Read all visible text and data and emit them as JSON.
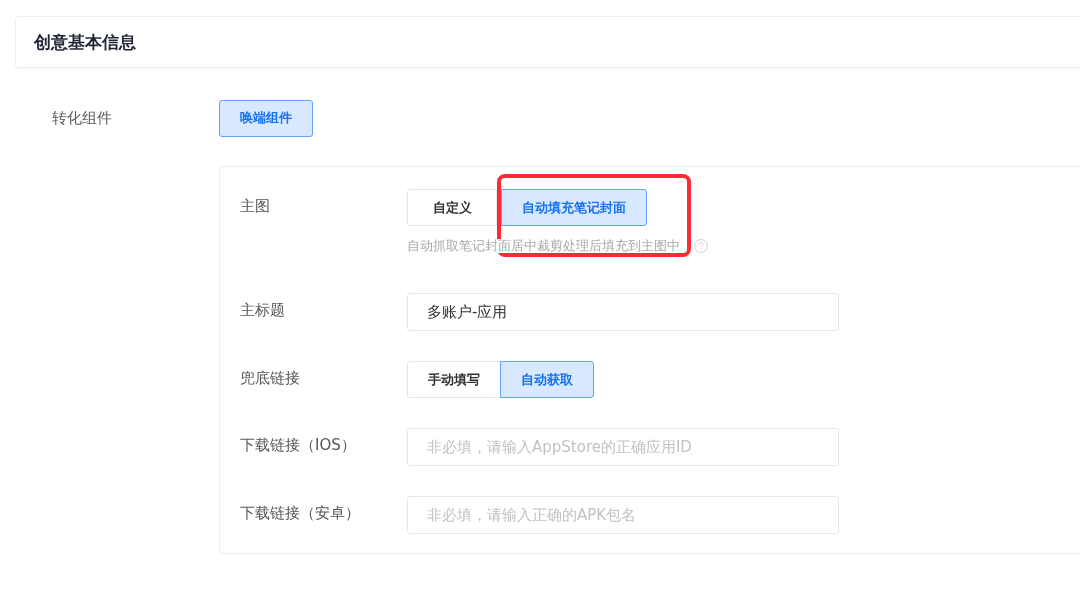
{
  "section_header": {
    "title": "创意基本信息"
  },
  "conversion": {
    "label": "转化组件",
    "options": [
      {
        "label": "唤端组件",
        "selected": true,
        "highlighted": false
      }
    ]
  },
  "component_panel": {
    "fields": [
      {
        "kind": "choice",
        "label": "主图",
        "options": [
          {
            "label": "自定义",
            "selected": false,
            "highlighted": false
          },
          {
            "label": "自动填充笔记封面",
            "selected": true,
            "highlighted": true
          }
        ],
        "hint": "自动抓取笔记封面居中裁剪处理后填充到主图中"
      },
      {
        "kind": "text",
        "label": "主标题",
        "value": "多账户-应用"
      },
      {
        "kind": "choice",
        "label": "兜底链接",
        "options": [
          {
            "label": "手动填写",
            "selected": false,
            "highlighted": false
          },
          {
            "label": "自动获取",
            "selected": true,
            "highlighted": false
          }
        ]
      },
      {
        "kind": "text",
        "label": "下载链接（IOS）",
        "placeholder": "非必填，请输入AppStore的正确应用ID"
      },
      {
        "kind": "text",
        "label": "下载链接（安卓）",
        "placeholder": "非必填，请输入正确的APK包名"
      }
    ]
  }
}
